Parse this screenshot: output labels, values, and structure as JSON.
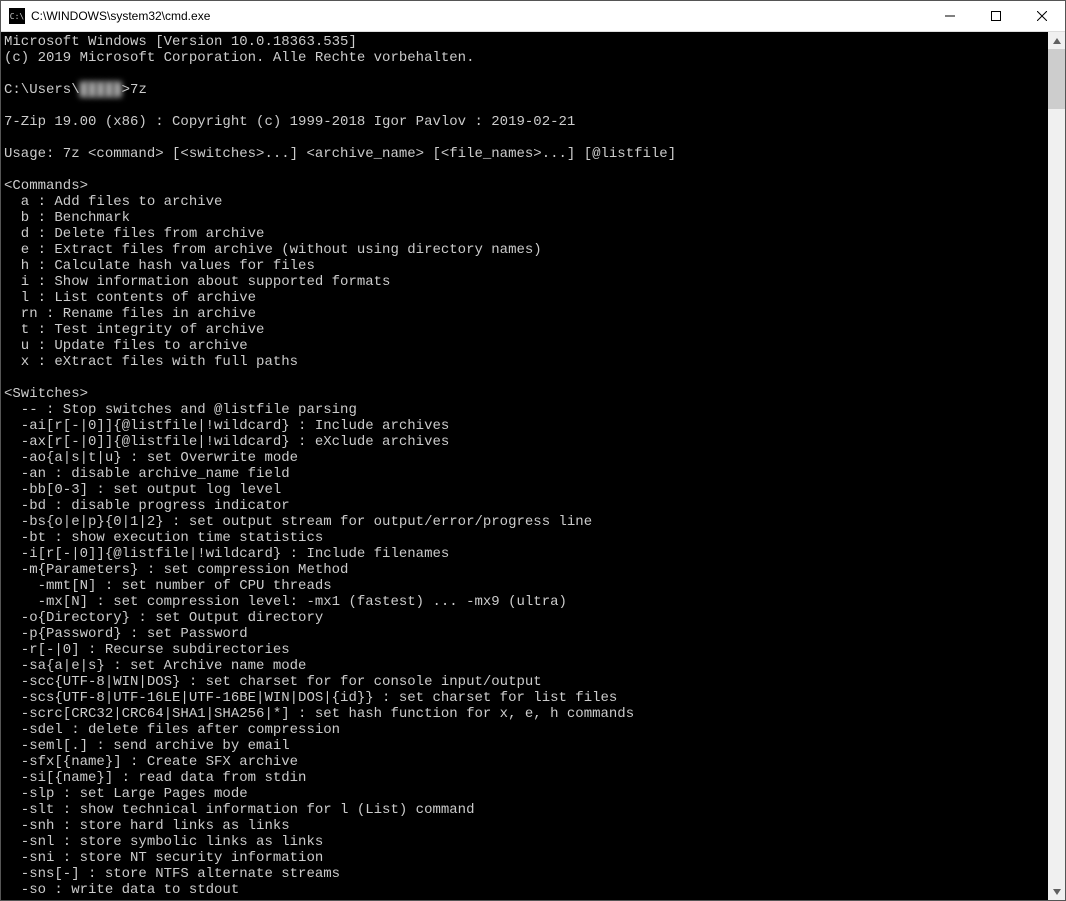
{
  "window": {
    "title": "C:\\WINDOWS\\system32\\cmd.exe",
    "icon_label": "C:\\"
  },
  "terminal": {
    "header": {
      "line1": "Microsoft Windows [Version 10.0.18363.535]",
      "line2": "(c) 2019 Microsoft Corporation. Alle Rechte vorbehalten."
    },
    "prompt": {
      "prefix": "C:\\Users\\",
      "user_redacted": "█████",
      "suffix": ">7z"
    },
    "app_banner": "7-Zip 19.00 (x86) : Copyright (c) 1999-2018 Igor Pavlov : 2019-02-21",
    "usage": "Usage: 7z <command> [<switches>...] <archive_name> [<file_names>...] [@listfile]",
    "commands_header": "<Commands>",
    "commands": [
      "  a : Add files to archive",
      "  b : Benchmark",
      "  d : Delete files from archive",
      "  e : Extract files from archive (without using directory names)",
      "  h : Calculate hash values for files",
      "  i : Show information about supported formats",
      "  l : List contents of archive",
      "  rn : Rename files in archive",
      "  t : Test integrity of archive",
      "  u : Update files to archive",
      "  x : eXtract files with full paths"
    ],
    "switches_header": "<Switches>",
    "switches": [
      "  -- : Stop switches and @listfile parsing",
      "  -ai[r[-|0]]{@listfile|!wildcard} : Include archives",
      "  -ax[r[-|0]]{@listfile|!wildcard} : eXclude archives",
      "  -ao{a|s|t|u} : set Overwrite mode",
      "  -an : disable archive_name field",
      "  -bb[0-3] : set output log level",
      "  -bd : disable progress indicator",
      "  -bs{o|e|p}{0|1|2} : set output stream for output/error/progress line",
      "  -bt : show execution time statistics",
      "  -i[r[-|0]]{@listfile|!wildcard} : Include filenames",
      "  -m{Parameters} : set compression Method",
      "    -mmt[N] : set number of CPU threads",
      "    -mx[N] : set compression level: -mx1 (fastest) ... -mx9 (ultra)",
      "  -o{Directory} : set Output directory",
      "  -p{Password} : set Password",
      "  -r[-|0] : Recurse subdirectories",
      "  -sa{a|e|s} : set Archive name mode",
      "  -scc{UTF-8|WIN|DOS} : set charset for for console input/output",
      "  -scs{UTF-8|UTF-16LE|UTF-16BE|WIN|DOS|{id}} : set charset for list files",
      "  -scrc[CRC32|CRC64|SHA1|SHA256|*] : set hash function for x, e, h commands",
      "  -sdel : delete files after compression",
      "  -seml[.] : send archive by email",
      "  -sfx[{name}] : Create SFX archive",
      "  -si[{name}] : read data from stdin",
      "  -slp : set Large Pages mode",
      "  -slt : show technical information for l (List) command",
      "  -snh : store hard links as links",
      "  -snl : store symbolic links as links",
      "  -sni : store NT security information",
      "  -sns[-] : store NTFS alternate streams",
      "  -so : write data to stdout"
    ]
  }
}
